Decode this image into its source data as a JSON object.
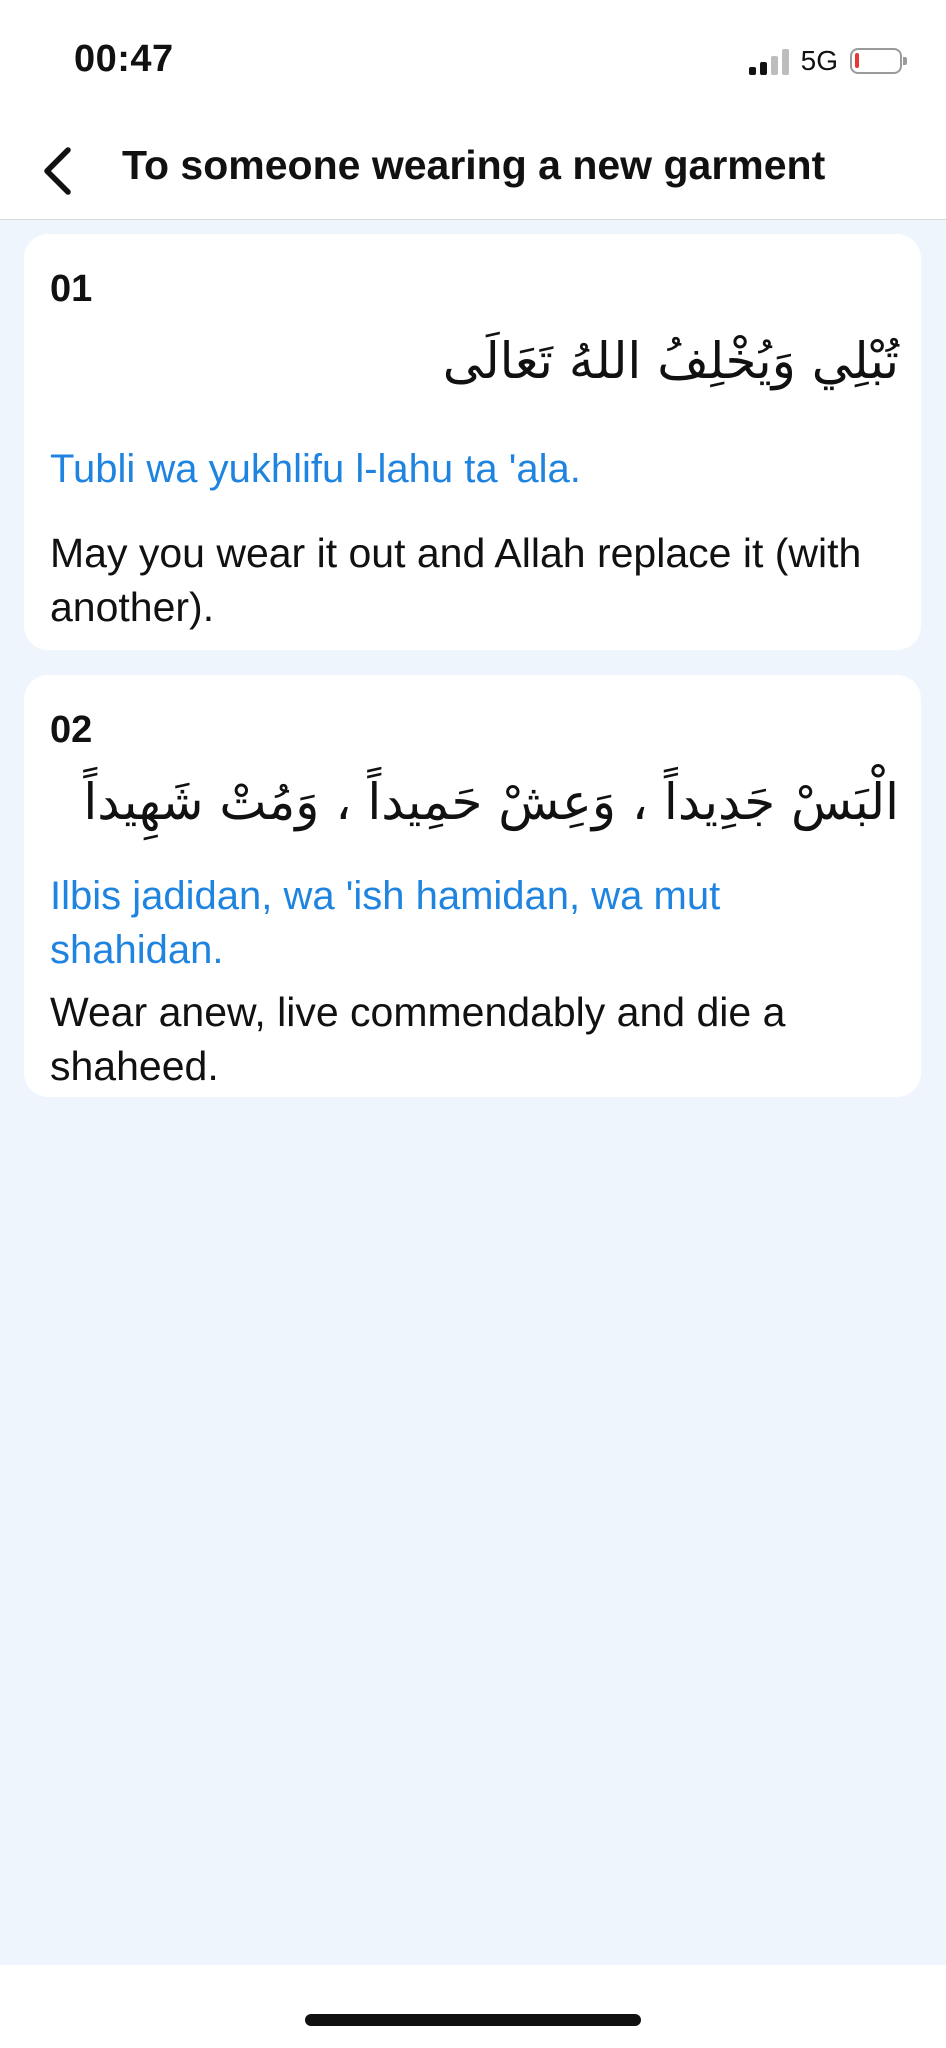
{
  "status_bar": {
    "time": "00:47",
    "network": "5G"
  },
  "nav": {
    "title": "To someone wearing a new garment"
  },
  "duas": [
    {
      "number": "01",
      "arabic": "تُبْلِي وَيُخْلِفُ اللهُ تَعَالَى",
      "transliteration": "Tubli wa yukhlifu l-lahu ta 'ala.",
      "translation": "May you wear it out and Allah replace it (with another)."
    },
    {
      "number": "02",
      "arabic": "الْبَسْ جَدِيداً ، وَعِشْ حَمِيداً ، وَمُتْ شَهِيداً",
      "transliteration": "Ilbis jadidan, wa 'ish hamidan, wa mut shahidan.",
      "translation": "Wear anew, live commendably and die a shaheed."
    }
  ],
  "colors": {
    "accent": "#1f84e0",
    "content_background": "#eef5fd",
    "battery_low": "#e53935"
  },
  "icons": {
    "back": "chevron-left-icon",
    "signal": "cellular-signal-icon",
    "battery": "battery-icon"
  }
}
